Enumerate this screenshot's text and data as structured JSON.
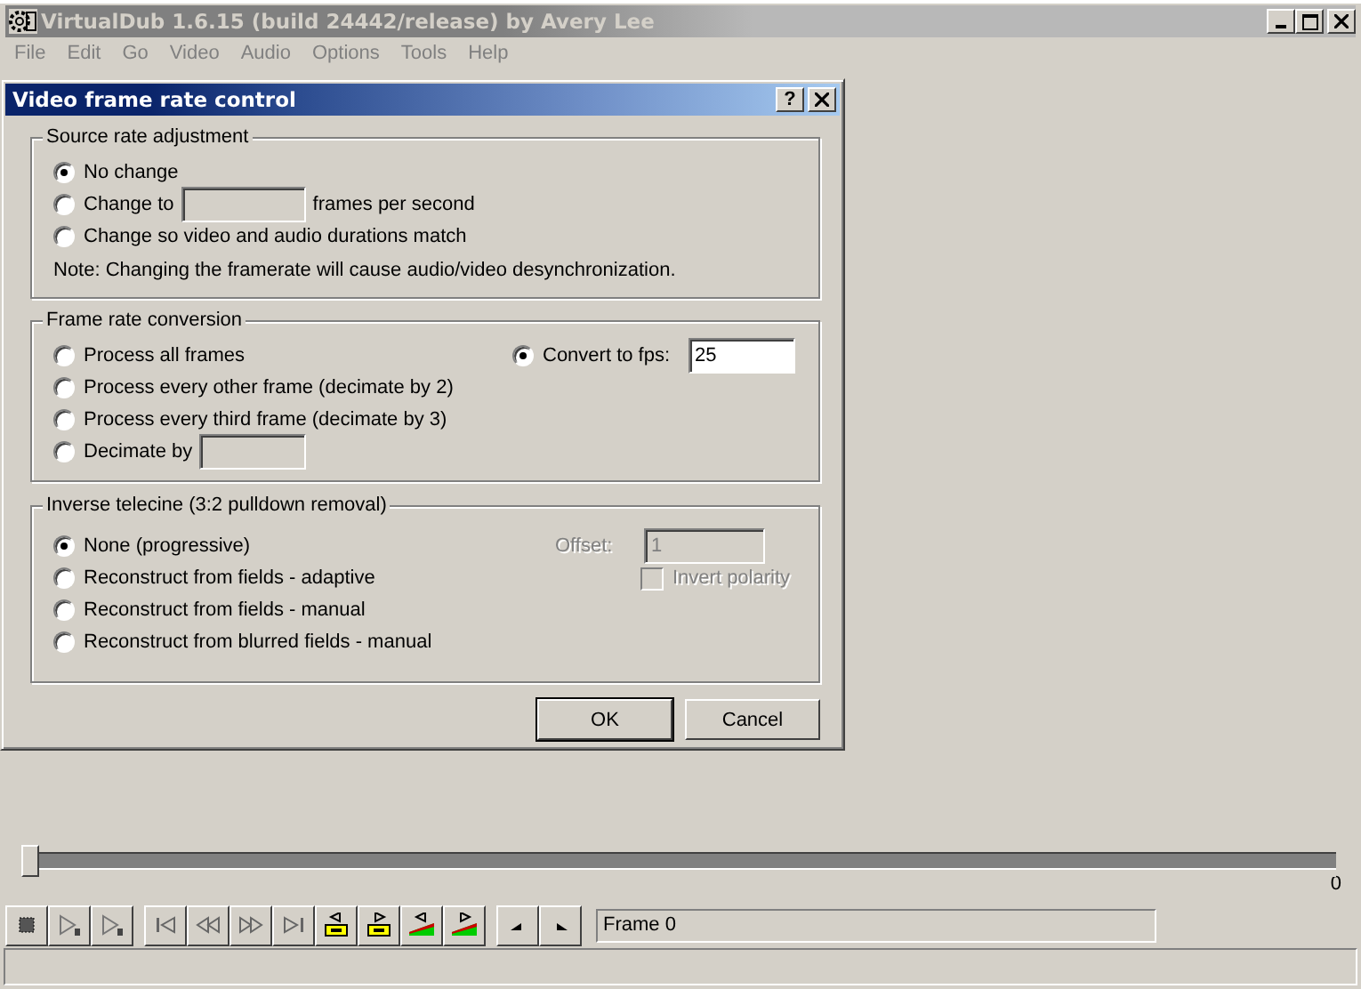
{
  "window": {
    "title": "VirtualDub 1.6.15 (build 24442/release) by Avery Lee",
    "menu": [
      "File",
      "Edit",
      "Go",
      "Video",
      "Audio",
      "Options",
      "Tools",
      "Help"
    ]
  },
  "dialog": {
    "title": "Video frame rate control",
    "help": "?",
    "source_rate": {
      "legend": "Source rate adjustment",
      "options": [
        {
          "kind": "plain",
          "label": "No change",
          "selected": true
        },
        {
          "kind": "field",
          "label": "Change to",
          "suffix": "frames per second",
          "selected": false
        },
        {
          "kind": "plain",
          "label": "Change so video and audio durations match",
          "selected": false
        }
      ],
      "note": "Note: Changing the framerate will cause audio/video desynchronization."
    },
    "conversion": {
      "legend": "Frame rate conversion",
      "options": [
        {
          "kind": "plain",
          "label": "Process all frames",
          "selected": false
        },
        {
          "kind": "plain",
          "label": "Process every other frame (decimate by 2)",
          "selected": false
        },
        {
          "kind": "plain",
          "label": "Process every third frame (decimate by 3)",
          "selected": false
        },
        {
          "kind": "field",
          "label": "Decimate by",
          "selected": false
        }
      ],
      "convert": {
        "label": "Convert to fps:",
        "selected": true,
        "value": "25"
      }
    },
    "telecine": {
      "legend": "Inverse telecine (3:2 pulldown removal)",
      "options": [
        {
          "label": "None (progressive)",
          "selected": true
        },
        {
          "label": "Reconstruct from fields - adaptive",
          "selected": false
        },
        {
          "label": "Reconstruct from fields - manual",
          "selected": false
        },
        {
          "label": "Reconstruct from blurred fields - manual",
          "selected": false
        }
      ],
      "offset": {
        "label": "Offset:",
        "value": "1",
        "disabled": true
      },
      "invert": {
        "label": "Invert polarity",
        "checked": false,
        "disabled": true
      }
    },
    "buttons": [
      "OK",
      "Cancel"
    ]
  },
  "timeline": {
    "level": 0,
    "tick": "0"
  },
  "frame_field": "Frame 0"
}
